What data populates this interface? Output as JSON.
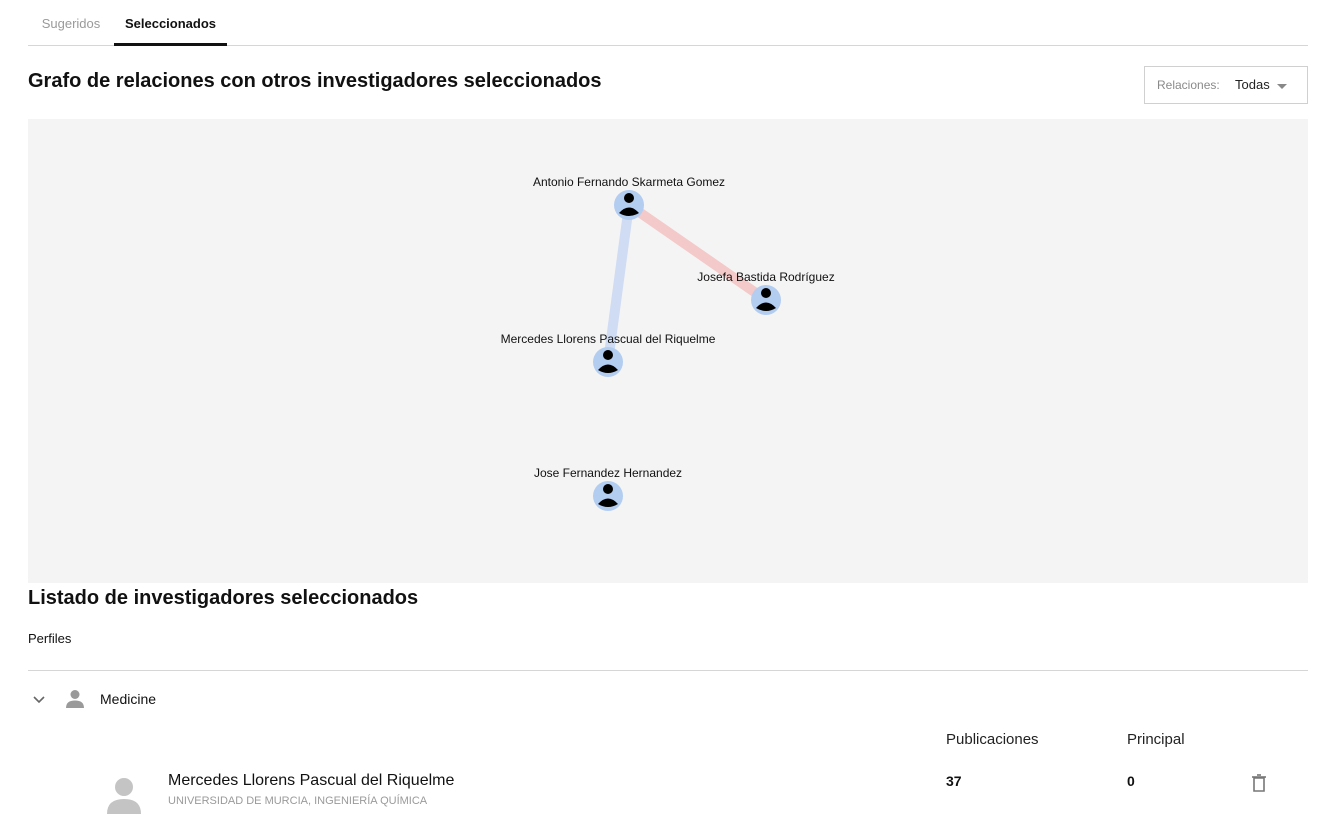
{
  "tabs": [
    {
      "label": "Sugeridos",
      "active": false
    },
    {
      "label": "Seleccionados",
      "active": true
    }
  ],
  "graph": {
    "title": "Grafo de relaciones con otros investigadores seleccionados",
    "relations_filter": {
      "label": "Relaciones:",
      "value": "Todas"
    },
    "nodes": [
      {
        "name": "Antonio Fernando Skarmeta Gomez"
      },
      {
        "name": "Josefa Bastida Rodríguez"
      },
      {
        "name": "Mercedes Llorens Pascual del Riquelme"
      },
      {
        "name": "Jose Fernandez Hernandez"
      }
    ],
    "edges": [
      {
        "from": "Antonio Fernando Skarmeta Gomez",
        "to": "Josefa Bastida Rodríguez",
        "color": "#f3c9c9"
      },
      {
        "from": "Antonio Fernando Skarmeta Gomez",
        "to": "Mercedes Llorens Pascual del Riquelme",
        "color": "#cfdcf3"
      }
    ],
    "node_color": "#b3cdf1",
    "background": "#f4f4f4"
  },
  "list": {
    "title": "Listado de investigadores seleccionados",
    "profiles_label": "Perfiles",
    "group": {
      "name": "Medicine",
      "icon": "person-icon",
      "toggle_icon": "chevron-down-icon"
    },
    "columns": {
      "publications": "Publicaciones",
      "principal": "Principal"
    },
    "researchers": [
      {
        "name": "Mercedes Llorens Pascual del Riquelme",
        "institution": "UNIVERSIDAD DE MURCIA, INGENIERÍA QUÍMICA",
        "publications": "37",
        "principal": "0"
      }
    ]
  }
}
